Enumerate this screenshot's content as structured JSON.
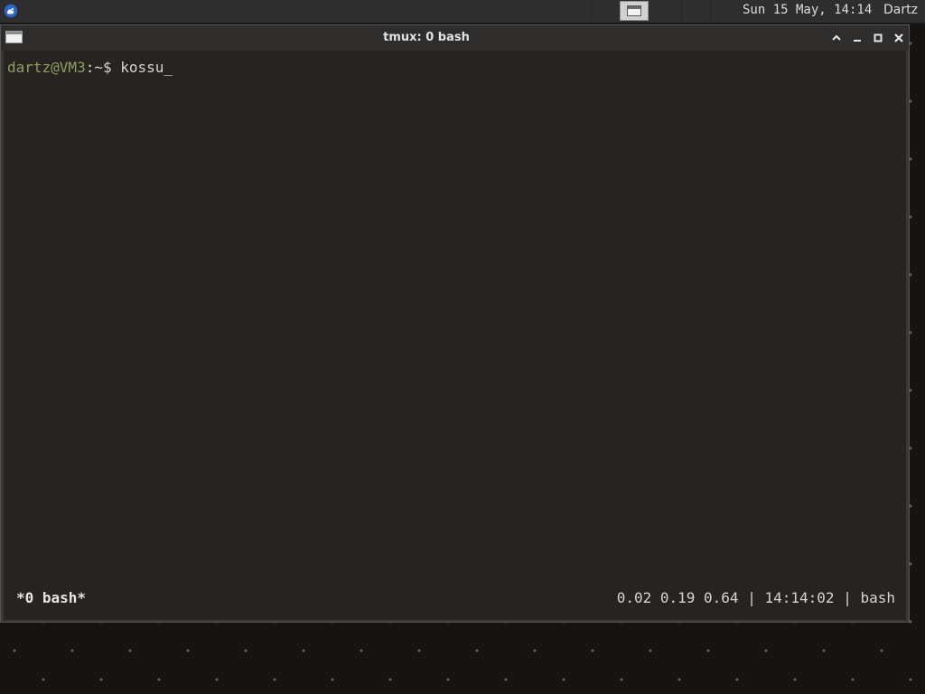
{
  "panel": {
    "menu_icon": "xfce-mouse-icon",
    "task_icon": "window-icon",
    "clock": "Sun 15 May, 14:14",
    "user": "Dartz"
  },
  "window": {
    "title": "tmux: 0 bash",
    "controls": [
      "shade-up-icon",
      "minimize-icon",
      "maximize-icon",
      "close-icon"
    ]
  },
  "terminal": {
    "prompt_user": "dartz@VM3",
    "prompt_path": ":~$ ",
    "command": "kossu",
    "cursor": "_"
  },
  "tmux": {
    "window_label": "*0 bash*",
    "load": "0.02 0.19 0.64",
    "separator": "|",
    "time": "14:14:02",
    "command": "bash"
  },
  "colors": {
    "terminal_bg": "#262320",
    "prompt_user": "#8f9f63",
    "text": "#d8d5cf"
  }
}
